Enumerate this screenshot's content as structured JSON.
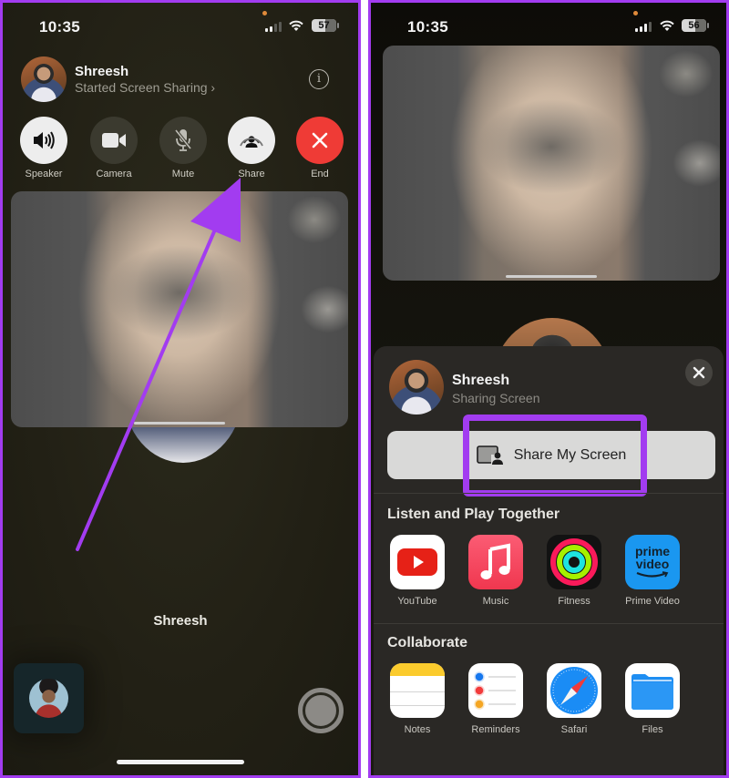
{
  "left_screen": {
    "status_bar": {
      "time": "10:35",
      "battery": "57"
    },
    "header": {
      "name": "Shreesh",
      "subtitle": "Started Screen Sharing",
      "subtitle_chevron": "›",
      "info_label": "i"
    },
    "controls": [
      {
        "label": "Speaker",
        "icon": "speaker-icon",
        "state": "on"
      },
      {
        "label": "Camera",
        "icon": "video-camera-icon",
        "state": "off"
      },
      {
        "label": "Mute",
        "icon": "mic-slash-icon",
        "state": "off"
      },
      {
        "label": "Share",
        "icon": "shareplay-icon",
        "state": "on"
      },
      {
        "label": "End",
        "icon": "close-icon",
        "state": "end"
      }
    ],
    "caller_name": "Shreesh",
    "annotation": {
      "type": "arrow",
      "color": "#a23cf0",
      "points_to": "Share"
    }
  },
  "right_screen": {
    "status_bar": {
      "time": "10:35",
      "battery": "56"
    },
    "sheet": {
      "name": "Shreesh",
      "subtitle": "Sharing Screen",
      "share_button_label": "Share My Screen",
      "highlight_color": "#a23cf0",
      "sections": [
        {
          "title": "Listen and Play Together",
          "apps": [
            {
              "name": "YouTube",
              "icon": "youtube-icon"
            },
            {
              "name": "Music",
              "icon": "music-icon"
            },
            {
              "name": "Fitness",
              "icon": "fitness-icon"
            },
            {
              "name": "Prime Video",
              "icon": "prime-video-icon",
              "icon_text_1": "prime",
              "icon_text_2": "video"
            }
          ]
        },
        {
          "title": "Collaborate",
          "apps": [
            {
              "name": "Notes",
              "icon": "notes-icon"
            },
            {
              "name": "Reminders",
              "icon": "reminders-icon"
            },
            {
              "name": "Safari",
              "icon": "safari-icon"
            },
            {
              "name": "Files",
              "icon": "files-icon"
            }
          ]
        }
      ]
    }
  },
  "colors": {
    "annotation": "#a23cf0",
    "end_call": "#ef3b36"
  }
}
